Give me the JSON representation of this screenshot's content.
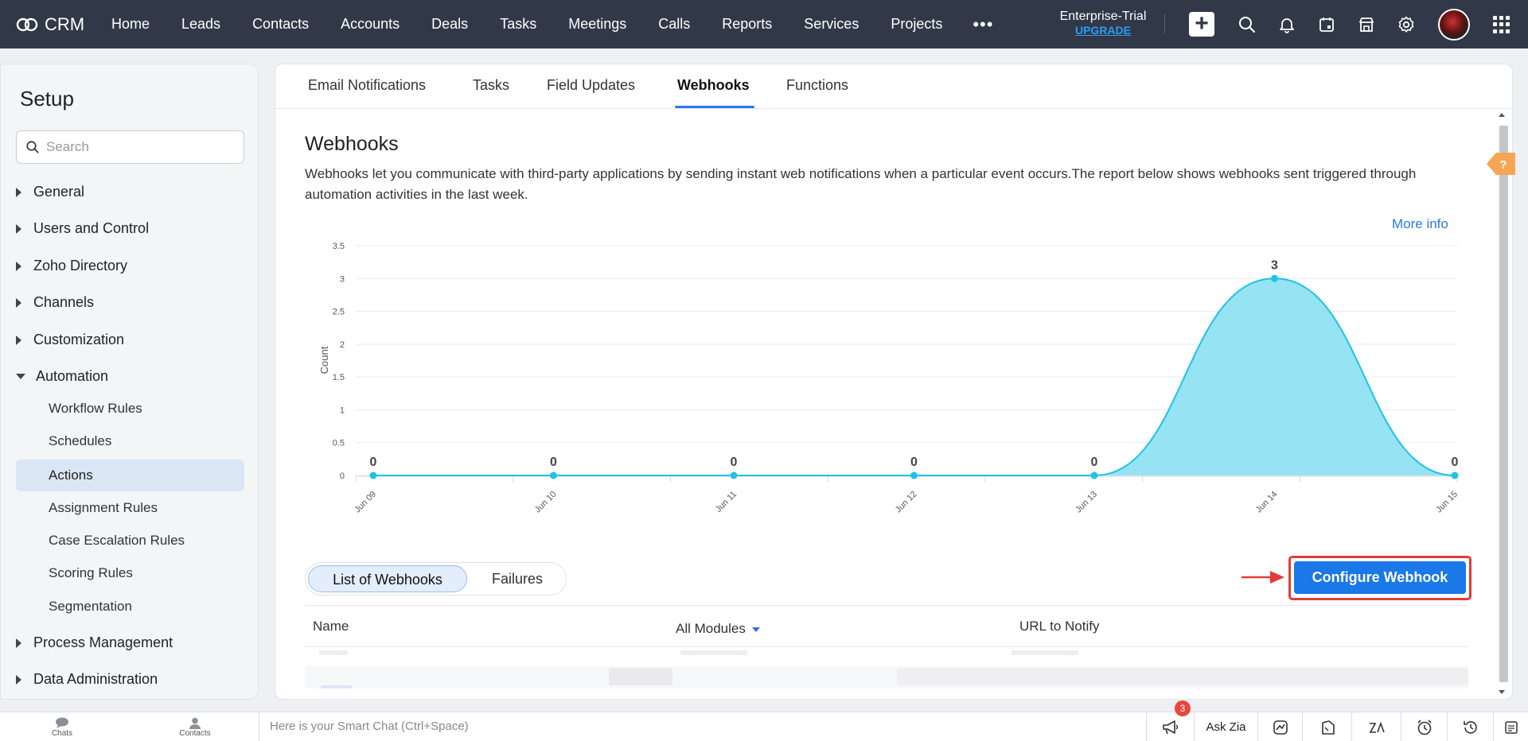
{
  "brand": {
    "name": "CRM"
  },
  "nav": {
    "items": [
      "Home",
      "Leads",
      "Contacts",
      "Accounts",
      "Deals",
      "Tasks",
      "Meetings",
      "Calls",
      "Reports",
      "Services",
      "Projects"
    ],
    "more": "•••"
  },
  "trial": {
    "edition": "Enterprise-Trial",
    "upgrade": "UPGRADE"
  },
  "topbar_icons": [
    "plus-icon",
    "search-icon",
    "bell-icon",
    "calendar-icon",
    "marketplace-icon",
    "gear-icon",
    "avatar",
    "apps-grid-icon"
  ],
  "sidebar": {
    "title": "Setup",
    "search_placeholder": "Search",
    "groups": [
      "General",
      "Users and Control",
      "Zoho Directory",
      "Channels",
      "Customization",
      "Automation",
      "Process Management",
      "Data Administration"
    ],
    "automation_items": [
      "Workflow Rules",
      "Schedules",
      "Actions",
      "Assignment Rules",
      "Case Escalation Rules",
      "Scoring Rules",
      "Segmentation"
    ],
    "active_item": "Actions"
  },
  "tabs": [
    "Email Notifications",
    "Tasks",
    "Field Updates",
    "Webhooks",
    "Functions"
  ],
  "active_tab": "Webhooks",
  "page": {
    "title": "Webhooks",
    "description": "Webhooks let you communicate with third-party applications by sending instant web notifications when a particular event occurs.The report below shows webhooks sent triggered through automation activities in the last week.",
    "more_info": "More info"
  },
  "chart_data": {
    "type": "area",
    "x": [
      "Jun 09",
      "Jun 10",
      "Jun 11",
      "Jun 12",
      "Jun 13",
      "Jun 14",
      "Jun 15"
    ],
    "values": [
      0,
      0,
      0,
      0,
      0,
      3,
      0
    ],
    "data_labels": [
      "0",
      "0",
      "0",
      "0",
      "0",
      "3",
      "0"
    ],
    "ylabel": "Count",
    "yticks": [
      "0",
      "0.5",
      "1",
      "1.5",
      "2",
      "2.5",
      "3",
      "3.5"
    ],
    "ylim": [
      0,
      3.5
    ],
    "grid": true,
    "colors": {
      "line": "#1ec3e3",
      "fill": "#8fe2f2"
    }
  },
  "segment": {
    "list": "List of Webhooks",
    "failures": "Failures",
    "active": "List of Webhooks"
  },
  "configure_button": "Configure Webhook",
  "table": {
    "columns": {
      "name": "Name",
      "modules": "All Modules",
      "url": "URL to Notify"
    }
  },
  "bottombar": {
    "chats": "Chats",
    "contacts": "Contacts",
    "smart_chat_placeholder": "Here is your Smart Chat (Ctrl+Space)",
    "ask_zia": "Ask Zia",
    "announce_badge": "3"
  }
}
